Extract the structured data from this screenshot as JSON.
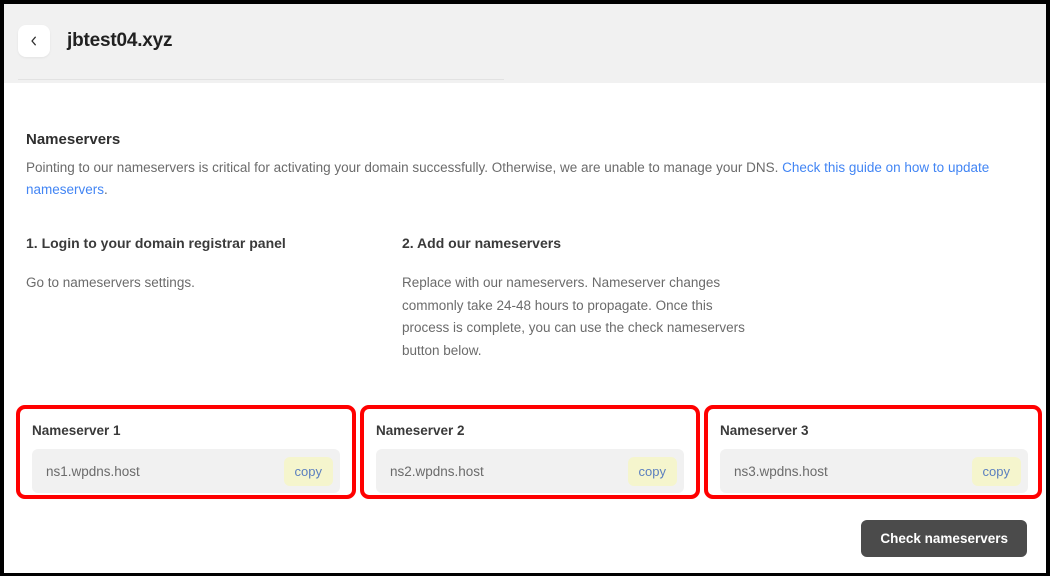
{
  "header": {
    "back_icon": "chevron-left-icon",
    "title": "jbtest04.xyz"
  },
  "main": {
    "section_title": "Nameservers",
    "description_before_link": "Pointing to our nameservers is critical for activating your domain successfully. Otherwise, we are unable to manage your DNS. ",
    "description_link": "Check this guide on how to update nameservers",
    "description_after_link": ".",
    "steps": [
      {
        "heading": "1. Login to your domain registrar panel",
        "text": "Go to nameservers settings."
      },
      {
        "heading": "2. Add our nameservers",
        "text": "Replace with our nameservers. Nameserver changes commonly take 24-48 hours to propagate. Once this process is complete, you can use the check nameservers button below."
      }
    ],
    "nameservers": [
      {
        "label": "Nameserver 1",
        "value": "ns1.wpdns.host",
        "copy_label": "copy"
      },
      {
        "label": "Nameserver 2",
        "value": "ns2.wpdns.host",
        "copy_label": "copy"
      },
      {
        "label": "Nameserver 3",
        "value": "ns3.wpdns.host",
        "copy_label": "copy"
      }
    ],
    "check_button": "Check nameservers"
  },
  "annotations": {
    "color": "#ff0000",
    "count": 3
  },
  "colors": {
    "header_background": "#f1f1f1",
    "body_background": "#ffffff",
    "link": "#4285f4",
    "field_background": "#f1f1f1",
    "copy_background": "#f5f5cd",
    "copy_text": "#5b7fbf",
    "button_background": "#4b4b4b",
    "button_text": "#ffffff",
    "frame_border": "#000000"
  }
}
